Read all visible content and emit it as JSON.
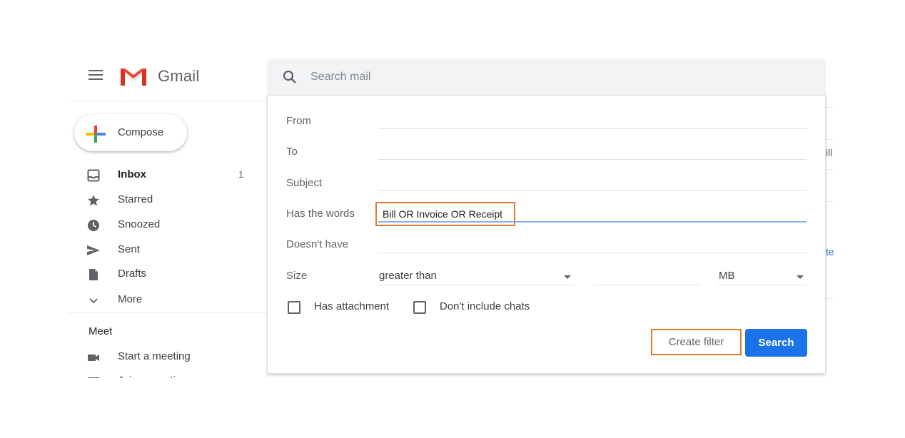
{
  "app": {
    "name": "Gmail",
    "brand_colors": {
      "red": "#ea4335",
      "blue": "#4285f4",
      "yellow": "#fbbc04",
      "green": "#34a853",
      "primary": "#1a73e8",
      "highlight": "#e07b2e"
    }
  },
  "header": {
    "menu_icon": "hamburger-menu-icon",
    "logo_text": "Gmail"
  },
  "search": {
    "placeholder": "Search mail",
    "icon": "search-icon"
  },
  "sidebar": {
    "compose_label": "Compose",
    "items": [
      {
        "label": "Inbox",
        "icon": "inbox-icon",
        "count": "1",
        "bold": true
      },
      {
        "label": "Starred",
        "icon": "star-icon"
      },
      {
        "label": "Snoozed",
        "icon": "clock-icon"
      },
      {
        "label": "Sent",
        "icon": "send-icon"
      },
      {
        "label": "Drafts",
        "icon": "draft-icon"
      },
      {
        "label": "More",
        "icon": "chevron-down-icon"
      }
    ],
    "meet": {
      "heading": "Meet",
      "items": [
        {
          "label": "Start a meeting",
          "icon": "video-camera-icon"
        },
        {
          "label": "Join a meeting",
          "icon": "keyboard-icon"
        }
      ]
    }
  },
  "advanced_search": {
    "fields": [
      {
        "label": "From",
        "value": ""
      },
      {
        "label": "To",
        "value": ""
      },
      {
        "label": "Subject",
        "value": ""
      },
      {
        "label": "Has the words",
        "value": "Bill OR Invoice OR Receipt"
      },
      {
        "label": "Doesn't have",
        "value": ""
      }
    ],
    "size": {
      "label": "Size",
      "comparator": "greater than",
      "value": "",
      "unit": "MB"
    },
    "checkboxes": [
      {
        "label": "Has attachment",
        "checked": false
      },
      {
        "label": "Don't include chats",
        "checked": false
      }
    ],
    "buttons": {
      "create_filter": "Create filter",
      "search": "Search"
    }
  },
  "background_fragments": [
    "ill",
    "te"
  ]
}
